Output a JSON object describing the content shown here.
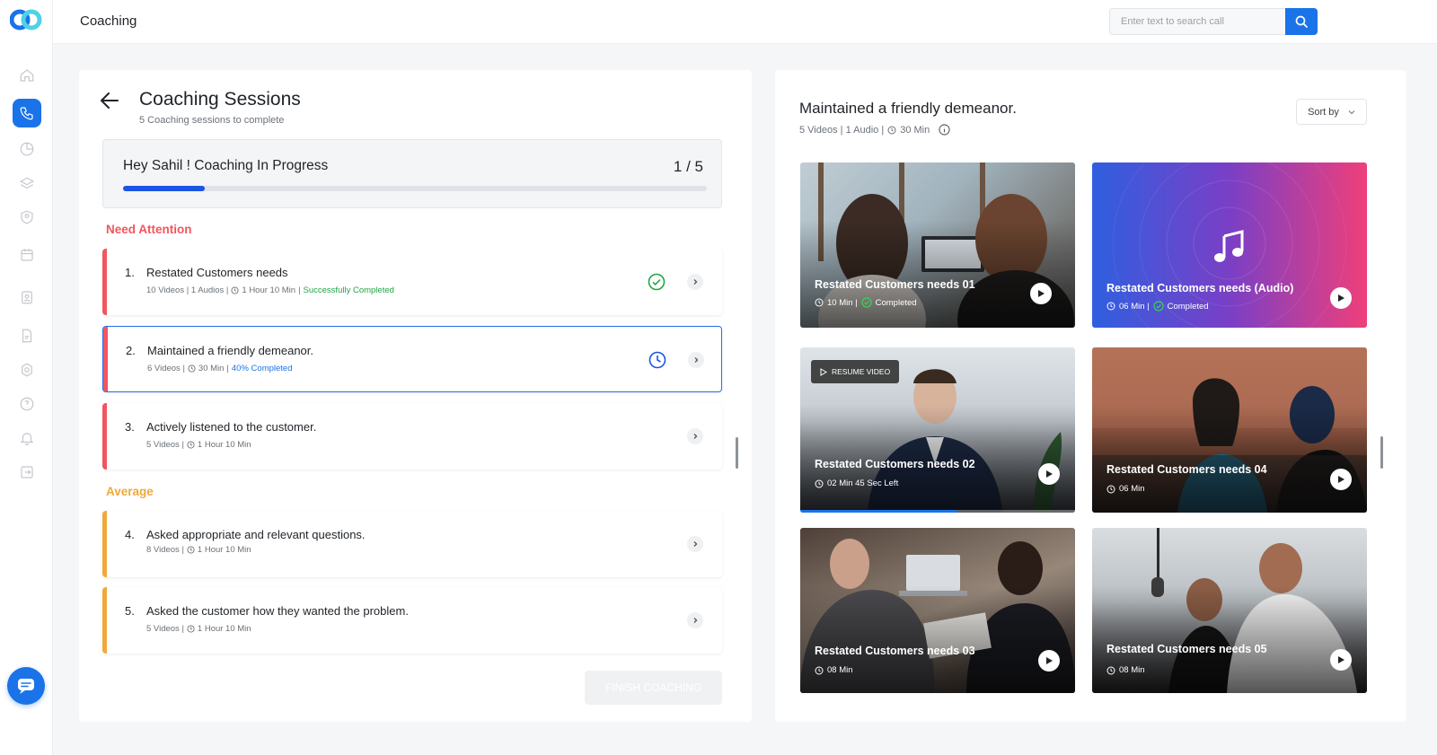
{
  "header": {
    "title": "Coaching",
    "search_placeholder": "Enter text to search call"
  },
  "sidebar": {
    "items": [
      {
        "name": "home-icon"
      },
      {
        "name": "phone-icon",
        "active": true
      },
      {
        "name": "pie-chart-icon"
      },
      {
        "name": "layers-icon"
      },
      {
        "name": "user-badge-icon"
      },
      {
        "name": "calendar-icon"
      },
      {
        "name": "id-card-icon"
      },
      {
        "name": "document-icon"
      },
      {
        "name": "settings-icon"
      },
      {
        "name": "help-icon"
      },
      {
        "name": "bell-icon"
      },
      {
        "name": "logout-icon"
      }
    ]
  },
  "sessions": {
    "title": "Coaching Sessions",
    "subtitle": "5 Coaching sessions to complete",
    "progress_text": "Hey Sahil ! Coaching In Progress",
    "progress_count": "1 / 5",
    "progress_value": 0.14,
    "attention_label": "Need Attention",
    "average_label": "Average",
    "items": [
      {
        "num": "1.",
        "title": "Restated Customers needs",
        "meta": "10 Videos | 1 Audios |",
        "time": "1 Hour 10 Min",
        "sep": "|",
        "status": "Successfully Completed"
      },
      {
        "num": "2.",
        "title": "Maintained a friendly demeanor.",
        "meta": "6 Videos |",
        "time": "30 Min",
        "sep": "|",
        "status": "40% Completed"
      },
      {
        "num": "3.",
        "title": "Actively listened to the customer.",
        "meta": "5 Videos |",
        "time": "1 Hour 10 Min",
        "sep": "",
        "status": ""
      },
      {
        "num": "4.",
        "title": "Asked appropriate and relevant questions.",
        "meta": "8 Videos |",
        "time": "1 Hour 10 Min",
        "sep": "",
        "status": ""
      },
      {
        "num": "5.",
        "title": "Asked the customer how they wanted the problem.",
        "meta": "5 Videos |",
        "time": "1 Hour 10 Min",
        "sep": "",
        "status": ""
      }
    ],
    "finish_label": "FINISH COACHING"
  },
  "detail": {
    "title": "Maintained a friendly demeanor.",
    "meta": "5 Videos | 1 Audio |",
    "duration": "30 Min",
    "sort_label": "Sort by",
    "cards": [
      {
        "title": "Restated Customers needs 01",
        "meta": "10 Min |",
        "status": "Completed"
      },
      {
        "title": "Restated Customers needs (Audio)",
        "meta": "06 Min |",
        "status": "Completed"
      },
      {
        "title": "Restated Customers needs 02",
        "meta": "02 Min 45 Sec Left",
        "resume": "RESUME VIDEO",
        "watched": 0.57
      },
      {
        "title": "Restated Customers needs 04",
        "meta": "06 Min"
      },
      {
        "title": "Restated Customers needs 03",
        "meta": "08 Min"
      },
      {
        "title": "Restated Customers needs 05",
        "meta": "08 Min"
      }
    ]
  },
  "colors": {
    "accent": "#1a73e8",
    "attention": "#f0565e",
    "average": "#f0a93b",
    "success": "#22a447"
  }
}
